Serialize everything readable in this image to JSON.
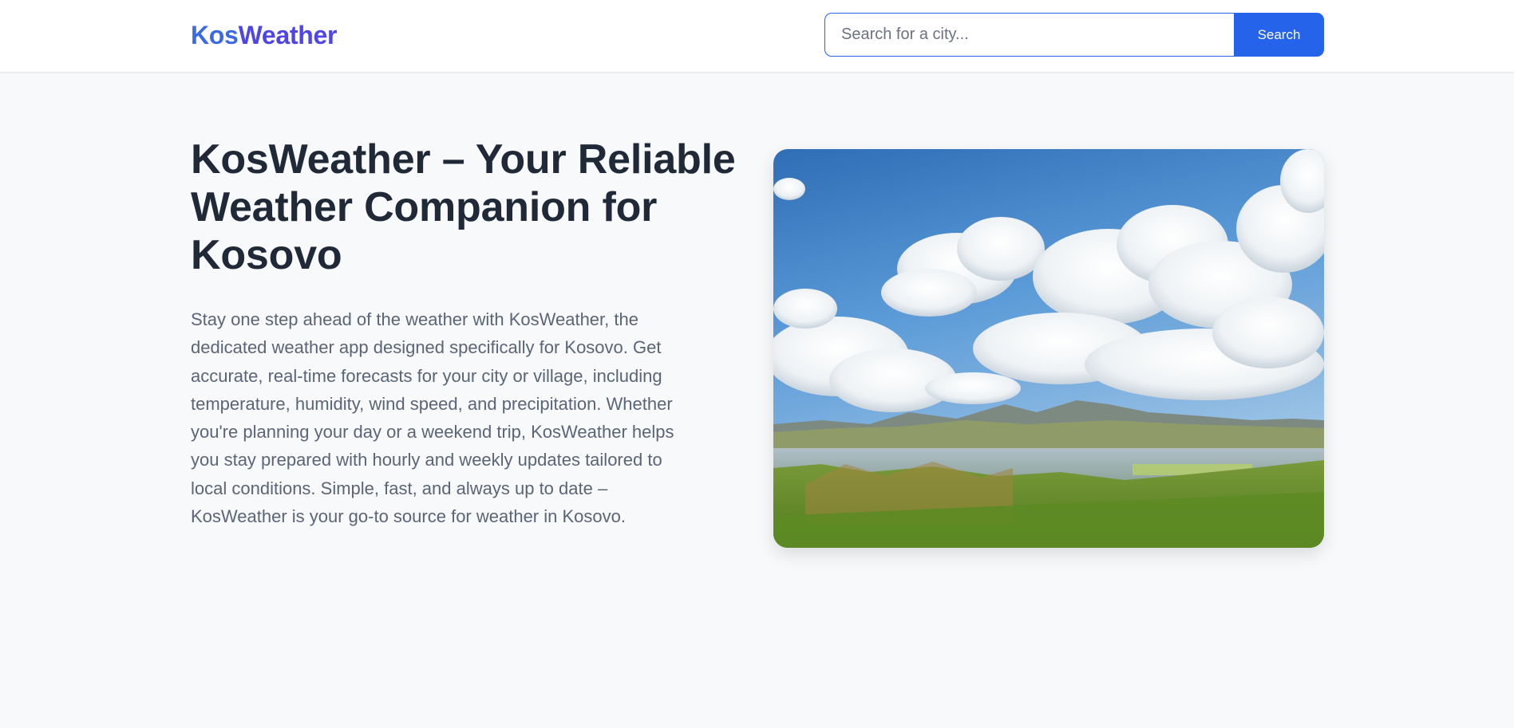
{
  "header": {
    "logo_part1": "Kos",
    "logo_part2": "Weather",
    "search_placeholder": "Search for a city...",
    "search_button_label": "Search"
  },
  "hero": {
    "title": "KosWeather – Your Reliable Weather Companion for Kosovo",
    "description": "Stay one step ahead of the weather with KosWeather, the dedicated weather app designed specifically for Kosovo. Get accurate, real-time forecasts for your city or village, including temperature, humidity, wind speed, and precipitation. Whether you're planning your day or a weekend trip, KosWeather helps you stay prepared with hourly and weekly updates tailored to local conditions. Simple, fast, and always up to date – KosWeather is your go-to source for weather in Kosovo.",
    "image_icon": "landscape-photo"
  },
  "colors": {
    "accent": "#2563eb",
    "logo": "#4f46e5",
    "title": "#1f2937",
    "body_text": "#5a6577",
    "background": "#f8f9fb"
  }
}
